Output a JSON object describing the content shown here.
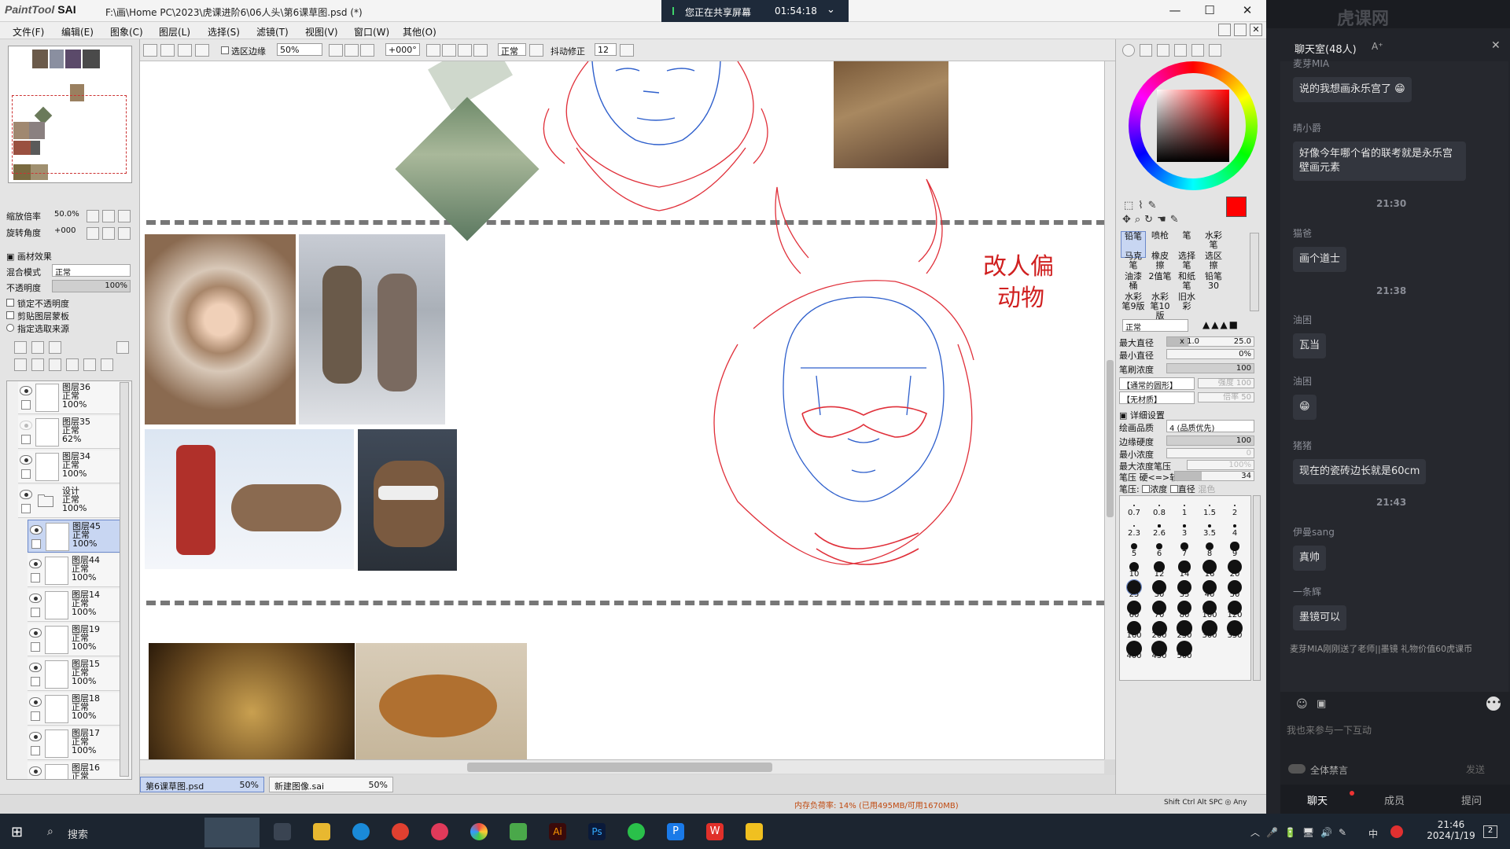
{
  "window": {
    "logo": "PaintTool",
    "logo_bold": "SAI",
    "path": "F:\\画\\Home PC\\2023\\虎课进阶6\\06人头\\第6课草图.psd (*)",
    "minimize": "—",
    "maximize": "☐",
    "close": "✕"
  },
  "share": {
    "text": "您正在共享屏幕",
    "time": "01:54:18"
  },
  "menu": [
    "文件(F)",
    "编辑(E)",
    "图象(C)",
    "图层(L)",
    "选择(S)",
    "滤镜(T)",
    "视图(V)",
    "窗口(W)",
    "其他(O)"
  ],
  "left": {
    "zoom_label": "缩放倍率",
    "zoom_value": "50.0%",
    "rot_label": "旋转角度",
    "rot_value": "+000",
    "effect_label": "画材效果",
    "blend_label": "混合模式",
    "blend_value": "正常",
    "opacity_label": "不透明度",
    "opacity_value": "100%",
    "chk1": "锁定不透明度",
    "chk2": "剪贴图层蒙板",
    "chk3": "指定选取来源",
    "layers": [
      {
        "name": "图层36",
        "mode": "正常",
        "opacity": "100%"
      },
      {
        "name": "图层35",
        "mode": "正常",
        "opacity": "62%"
      },
      {
        "name": "图层34",
        "mode": "正常",
        "opacity": "100%"
      },
      {
        "name": "设计",
        "mode": "正常",
        "opacity": "100%"
      },
      {
        "name": "图层45",
        "mode": "正常",
        "opacity": "100%"
      },
      {
        "name": "图层44",
        "mode": "正常",
        "opacity": "100%"
      },
      {
        "name": "图层14",
        "mode": "正常",
        "opacity": "100%"
      },
      {
        "name": "图层19",
        "mode": "正常",
        "opacity": "100%"
      },
      {
        "name": "图层15",
        "mode": "正常",
        "opacity": "100%"
      },
      {
        "name": "图层18",
        "mode": "正常",
        "opacity": "100%"
      },
      {
        "name": "图层17",
        "mode": "正常",
        "opacity": "100%"
      },
      {
        "name": "图层16",
        "mode": "正常",
        "opacity": ""
      }
    ]
  },
  "toolbar": {
    "sel_edge": "选区边缘",
    "zoom": "50%",
    "angle": "+000°",
    "mode": "正常",
    "stab_label": "抖动修正",
    "stab_value": "12"
  },
  "canvas": {
    "note_line1": "改人偏",
    "note_line2": "动物"
  },
  "doctabs": [
    {
      "name": "第6课草图.psd",
      "zoom": "50%"
    },
    {
      "name": "新建图像.sai",
      "zoom": "50%"
    }
  ],
  "status": {
    "memory": "内存负荷率: 14% (已用495MB/可用1670MB)",
    "keys": "Shift Ctrl Alt SPC ◎ Any"
  },
  "right": {
    "brushes": [
      "铅笔",
      "喷枪",
      "笔",
      "水彩笔",
      "马克笔",
      "橡皮擦",
      "选择笔",
      "选区擦",
      "油漆桶",
      "2值笔",
      "和纸笔",
      "铅笔30",
      "水彩笔9版",
      "水彩笔10版",
      "旧水彩",
      ""
    ],
    "mode": "正常",
    "max_d_label": "最大直径",
    "max_d_mult": "x 1.0",
    "max_d_val": "25.0",
    "min_d_label": "最小直径",
    "min_d_val": "0%",
    "density_label": "笔刷浓度",
    "density_val": "100",
    "shape1": "【通常的圆形】",
    "shape1_val": "强度 100",
    "shape2": "【无材质】",
    "shape2_val": "倍率 50",
    "detail": "详细设置",
    "quality_label": "绘画品质",
    "quality_val": "4 (品质优先)",
    "hardness_label": "边缘硬度",
    "hardness_val": "100",
    "min_dens_label": "最小浓度",
    "min_dens_val": "0",
    "max_press_label": "最大浓度笔压",
    "max_press_val": "100%",
    "press_label": "笔压 硬<=>软",
    "press_val": "34",
    "press2_label": "笔压:",
    "press2_a": "浓度",
    "press2_b": "直径",
    "press2_c": "混色",
    "sizes": [
      "0.7",
      "0.8",
      "1",
      "1.5",
      "2",
      "2.3",
      "2.6",
      "3",
      "3.5",
      "4",
      "5",
      "6",
      "7",
      "8",
      "9",
      "10",
      "12",
      "14",
      "16",
      "20",
      "25",
      "30",
      "35",
      "40",
      "50",
      "60",
      "70",
      "80",
      "100",
      "120",
      "160",
      "200",
      "250",
      "300",
      "350",
      "400",
      "450",
      "500"
    ]
  },
  "chat": {
    "title": "聊天室(48人)",
    "font_btn": "A⁺",
    "close": "✕",
    "messages": [
      {
        "user": "麦芽MIA",
        "text": "说的我想画永乐宫了 😁"
      },
      {
        "user": "晴小爵",
        "text": "好像今年哪个省的联考就是永乐宫壁画元素"
      },
      {
        "time": "21:30"
      },
      {
        "user": "猫爸",
        "text": "画个道士"
      },
      {
        "time": "21:38"
      },
      {
        "user": "油困",
        "text": "瓦当"
      },
      {
        "user": "油困",
        "text": "😁"
      },
      {
        "user": "猪猪",
        "text": "现在的瓷砖边长就是60cm"
      },
      {
        "time": "21:43"
      },
      {
        "user": "伊曼sang",
        "text": "真帅"
      },
      {
        "user": "一条辉",
        "text": "墨镜可以"
      }
    ],
    "gift": "麦芽MIA刚刚送了老师||墨镜 礼物价值60虎课币",
    "input_placeholder": "我也来参与一下互动",
    "mute": "全体禁言",
    "send": "发送",
    "tabs": [
      "聊天",
      "成员",
      "提问"
    ]
  },
  "taskbar": {
    "search": "搜索",
    "time": "21:46",
    "date": "2024/1/19",
    "lang": "中",
    "badge": "2"
  }
}
